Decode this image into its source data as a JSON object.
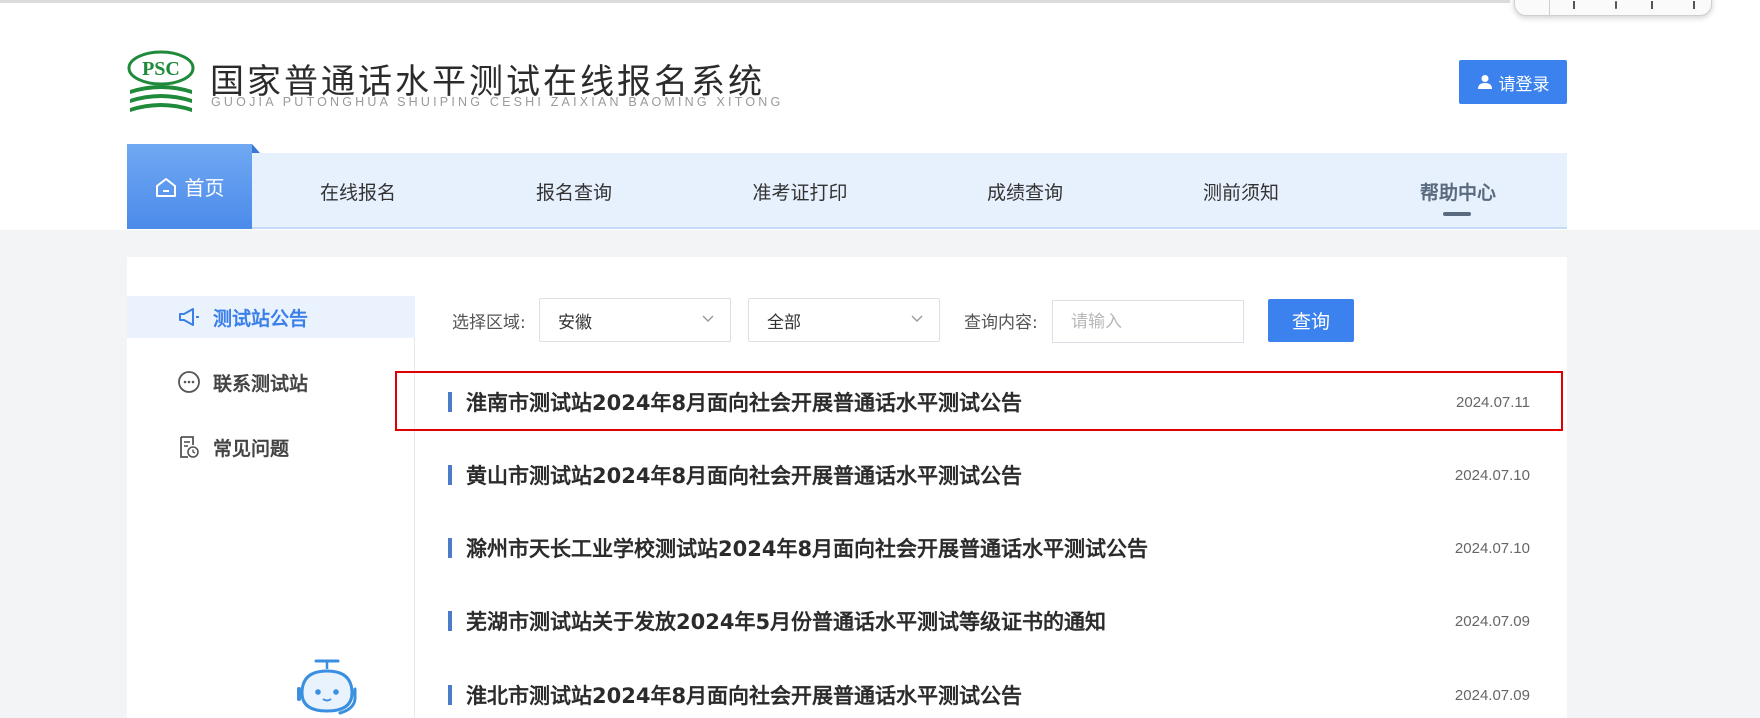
{
  "header": {
    "logo_text": "PSC",
    "title": "国家普通话水平测试在线报名系统",
    "subtitle": "GUOJIA PUTONGHUA SHUIPING CESHI ZAIXIAN BAOMING XITONG",
    "login_label": "请登录"
  },
  "nav": {
    "home": "首页",
    "items": [
      {
        "label": "在线报名"
      },
      {
        "label": "报名查询"
      },
      {
        "label": "准考证打印"
      },
      {
        "label": "成绩查询"
      },
      {
        "label": "测前须知"
      },
      {
        "label": "帮助中心"
      }
    ],
    "active": "帮助中心"
  },
  "sidebar": {
    "items": [
      {
        "label": "测试站公告",
        "icon": "megaphone-icon",
        "active": true
      },
      {
        "label": "联系测试站",
        "icon": "chat-bubble-icon",
        "active": false
      },
      {
        "label": "常见问题",
        "icon": "document-clock-icon",
        "active": false
      }
    ]
  },
  "filters": {
    "region_label": "选择区域:",
    "region_value": "安徽",
    "scope_value": "全部",
    "query_label": "查询内容:",
    "query_placeholder": "请输入",
    "search_label": "查询"
  },
  "list": [
    {
      "title": "淮南市测试站2024年8月面向社会开展普通话水平测试公告",
      "date": "2024.07.11",
      "highlighted": true
    },
    {
      "title": "黄山市测试站2024年8月面向社会开展普通话水平测试公告",
      "date": "2024.07.10"
    },
    {
      "title": "滁州市天长工业学校测试站2024年8月面向社会开展普通话水平测试公告",
      "date": "2024.07.10"
    },
    {
      "title": "芜湖市测试站关于发放2024年5月份普通话水平测试等级证书的通知",
      "date": "2024.07.09"
    },
    {
      "title": "淮北市测试站2024年8月面向社会开展普通话水平测试公告",
      "date": "2024.07.09"
    }
  ],
  "colors": {
    "accent": "#3b82ee",
    "nav_bg": "#e7f1fd",
    "highlight_border": "#e00000",
    "logo_green": "#1f8a3a"
  }
}
